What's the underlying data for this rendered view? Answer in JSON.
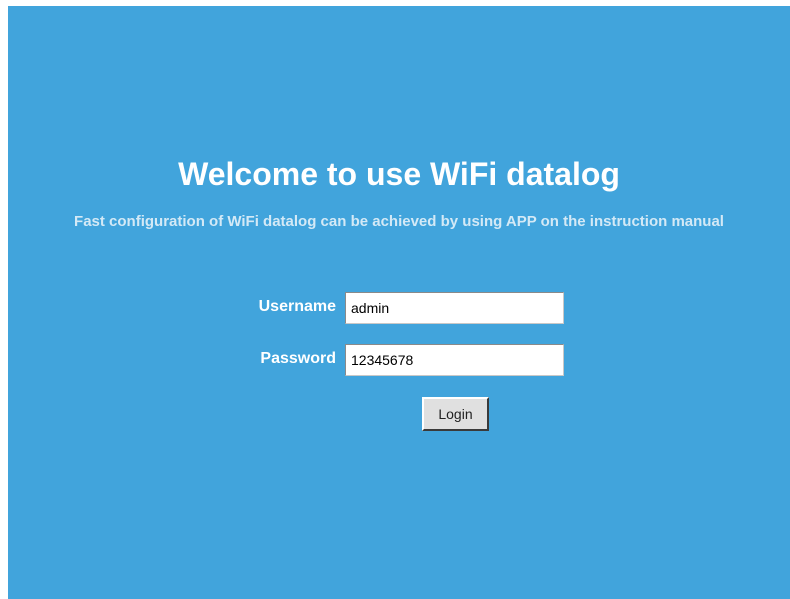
{
  "page": {
    "title": "Welcome to use WiFi datalog",
    "subtitle": "Fast configuration of WiFi datalog can be achieved by using APP on the instruction manual"
  },
  "form": {
    "username_label": "Username",
    "username_value": "admin",
    "password_label": "Password",
    "password_value": "12345678",
    "login_label": "Login"
  },
  "colors": {
    "background": "#41a4dc",
    "title": "#ffffff",
    "subtitle": "#d3e9f6",
    "button": "#e0e0e0"
  }
}
